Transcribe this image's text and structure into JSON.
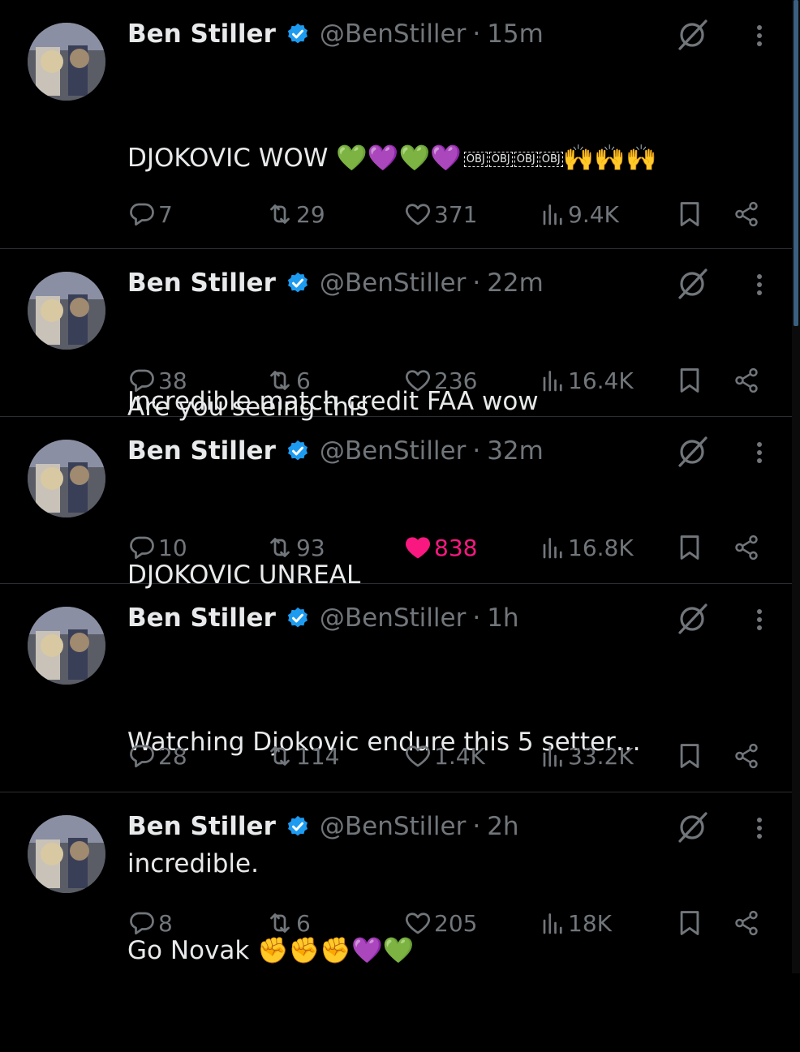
{
  "author": {
    "name": "Ben Stiller",
    "handle": "@BenStiller"
  },
  "separator": "·",
  "colors": {
    "background": "#000000",
    "text": "#e7e9ea",
    "muted": "#71767b",
    "verified": "#1d9bf0",
    "like": "#f91880",
    "divider": "#2a2e32"
  },
  "tweets": [
    {
      "time": "15m",
      "lines": [
        "DJOKOVIC WOW 💚💜💚💜",
        "",
        "Incredible match credit FAA wow"
      ],
      "emoji_tail": [
        "OBJ",
        "OBJ",
        "OBJ",
        "OBJ",
        "🙌",
        "🙌",
        "🙌"
      ],
      "replies": "7",
      "reposts": "29",
      "likes": "371",
      "views": "9.4K",
      "liked": false
    },
    {
      "time": "22m",
      "lines": [
        "Are you seeing this"
      ],
      "replies": "38",
      "reposts": "6",
      "likes": "236",
      "views": "16.4K",
      "liked": false
    },
    {
      "time": "32m",
      "lines": [
        "DJOKOVIC UNREAL"
      ],
      "replies": "10",
      "reposts": "93",
      "likes": "838",
      "views": "16.8K",
      "liked": true
    },
    {
      "time": "1h",
      "lines": [
        "Watching Djokovic endure this 5 setter…",
        "incredible."
      ],
      "replies": "28",
      "reposts": "114",
      "likes": "1.4K",
      "views": "33.2K",
      "liked": false
    },
    {
      "time": "2h",
      "lines": [
        "Go Novak ✊✊✊💜💚"
      ],
      "replies": "8",
      "reposts": "6",
      "likes": "205",
      "views": "18K",
      "liked": false
    }
  ],
  "icons": {
    "reply": "reply-icon",
    "repost": "repost-icon",
    "like": "heart-icon",
    "views": "views-icon",
    "bookmark": "bookmark-icon",
    "share": "share-icon",
    "grok": "grok-icon",
    "more": "more-icon",
    "verified": "verified-badge-icon"
  }
}
